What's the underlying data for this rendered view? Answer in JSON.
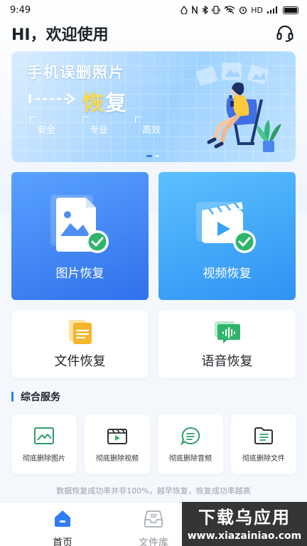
{
  "status_bar": {
    "time": "9:49",
    "icons_text": "HD"
  },
  "header": {
    "greeting": "HI，欢迎使用",
    "support_icon": "headset-icon"
  },
  "banner": {
    "title": "手机误删照片",
    "subtitle_highlight": "恢",
    "subtitle_rest": "复",
    "tags": [
      "安全",
      "专业",
      "高效"
    ],
    "page_count": 2,
    "active_page": 1
  },
  "main_cards": [
    {
      "label": "图片恢复",
      "icon": "image-file-icon"
    },
    {
      "label": "视频恢复",
      "icon": "video-clapper-icon"
    }
  ],
  "sub_cards": [
    {
      "label": "文件恢复",
      "icon": "document-icon"
    },
    {
      "label": "语音恢复",
      "icon": "voice-message-icon"
    }
  ],
  "section": {
    "title": "综合服务"
  },
  "services": [
    {
      "label": "彻底删除图片",
      "icon": "image-frame-icon"
    },
    {
      "label": "彻底删除视频",
      "icon": "video-icon"
    },
    {
      "label": "彻底删除音频",
      "icon": "audio-icon"
    },
    {
      "label": "彻底删除文件",
      "icon": "file-icon"
    }
  ],
  "notice": "数据恢复成功率并非100%，越早恢复，恢复成功率越高",
  "tabbar": {
    "tabs": [
      {
        "label": "首页",
        "icon": "home-icon",
        "active": true
      },
      {
        "label": "文件库",
        "icon": "inbox-tray-icon",
        "active": false
      }
    ]
  },
  "watermark": {
    "line1": "下载乌应用",
    "line2": "www.xiazainiao.com"
  },
  "colors": {
    "accent": "#2f7cf6",
    "check_green": "#2fb56a"
  }
}
